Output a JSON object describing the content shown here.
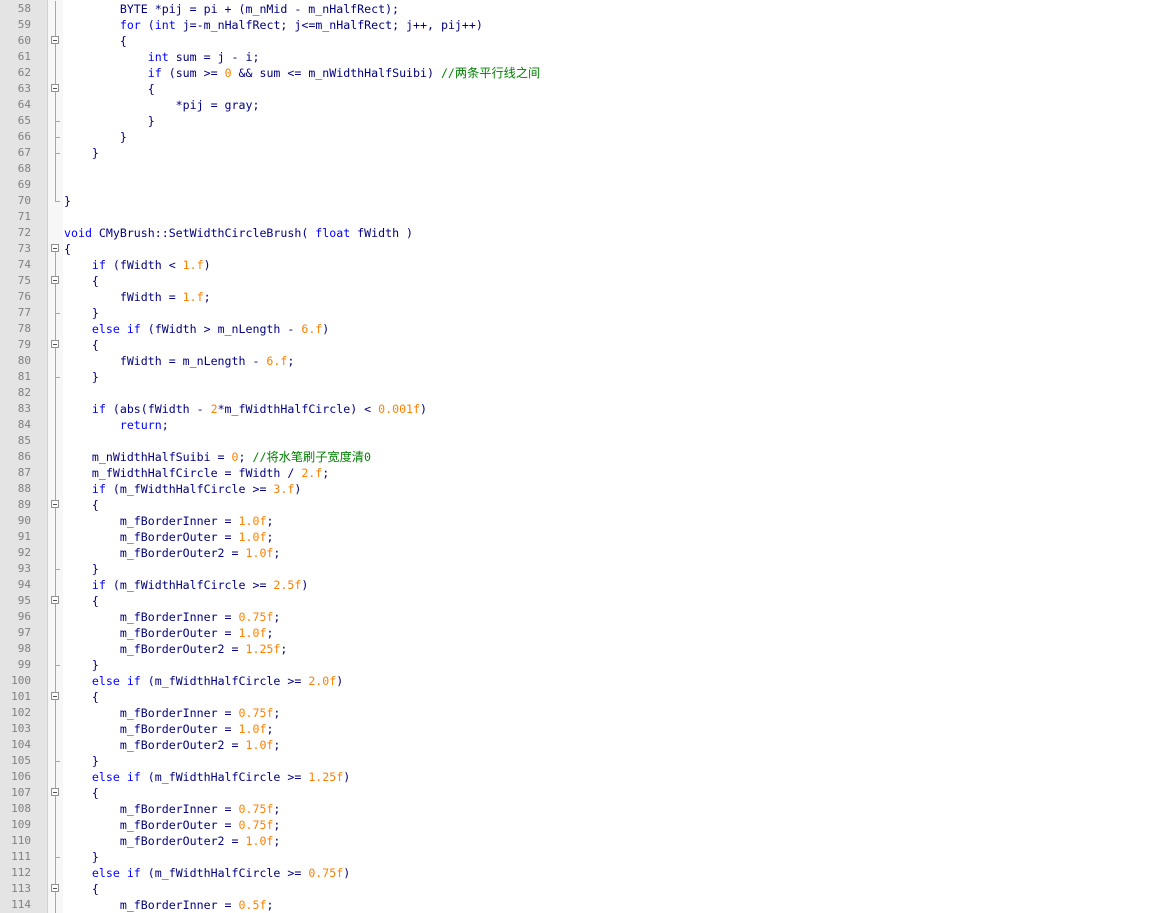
{
  "editor": {
    "colors": {
      "background": "#ffffff",
      "gutter": "#e4e4e4",
      "line_number": "#808080",
      "keyword": "#0000ff",
      "identifier": "#000080",
      "number": "#ff8000",
      "comment": "#008000"
    },
    "lines": [
      {
        "n": "58",
        "fold": "line",
        "tokens": [
          {
            "t": "        BYTE *pij = pi + (m_nMid - m_nHalfRect);",
            "c": ""
          }
        ]
      },
      {
        "n": "59",
        "fold": "line",
        "tokens": [
          {
            "t": "        ",
            "c": ""
          },
          {
            "t": "for",
            "c": "k"
          },
          {
            "t": " (",
            "c": ""
          },
          {
            "t": "int",
            "c": "k"
          },
          {
            "t": " j=-m_nHalfRect; j<=m_nHalfRect; j++, pij++)",
            "c": ""
          }
        ]
      },
      {
        "n": "60",
        "fold": "box",
        "tokens": [
          {
            "t": "        {",
            "c": ""
          }
        ]
      },
      {
        "n": "61",
        "fold": "line",
        "tokens": [
          {
            "t": "            ",
            "c": ""
          },
          {
            "t": "int",
            "c": "k"
          },
          {
            "t": " sum = j - i;",
            "c": ""
          }
        ]
      },
      {
        "n": "62",
        "fold": "line",
        "tokens": [
          {
            "t": "            ",
            "c": ""
          },
          {
            "t": "if",
            "c": "k"
          },
          {
            "t": " (sum >= ",
            "c": ""
          },
          {
            "t": "0",
            "c": "n"
          },
          {
            "t": " && sum <= m_nWidthHalfSuibi) ",
            "c": ""
          },
          {
            "t": "//",
            "c": "c"
          },
          {
            "t": "两条平行线之间",
            "c": "cc"
          }
        ]
      },
      {
        "n": "63",
        "fold": "box",
        "tokens": [
          {
            "t": "            {",
            "c": ""
          }
        ]
      },
      {
        "n": "64",
        "fold": "line",
        "tokens": [
          {
            "t": "                *pij = gray;",
            "c": ""
          }
        ]
      },
      {
        "n": "65",
        "fold": "end",
        "tokens": [
          {
            "t": "            }",
            "c": ""
          }
        ]
      },
      {
        "n": "66",
        "fold": "end",
        "tokens": [
          {
            "t": "        }",
            "c": ""
          }
        ]
      },
      {
        "n": "67",
        "fold": "end",
        "tokens": [
          {
            "t": "    }",
            "c": ""
          }
        ]
      },
      {
        "n": "68",
        "fold": "line",
        "tokens": []
      },
      {
        "n": "69",
        "fold": "line",
        "tokens": []
      },
      {
        "n": "70",
        "fold": "last",
        "tokens": [
          {
            "t": "}",
            "c": ""
          }
        ]
      },
      {
        "n": "71",
        "fold": "none",
        "tokens": []
      },
      {
        "n": "72",
        "fold": "none",
        "tokens": [
          {
            "t": "void",
            "c": "k"
          },
          {
            "t": " CMyBrush::SetWidthCircleBrush( ",
            "c": ""
          },
          {
            "t": "float",
            "c": "k"
          },
          {
            "t": " fWidth )",
            "c": ""
          }
        ]
      },
      {
        "n": "73",
        "fold": "top",
        "tokens": [
          {
            "t": "{",
            "c": ""
          }
        ]
      },
      {
        "n": "74",
        "fold": "line",
        "tokens": [
          {
            "t": "    ",
            "c": ""
          },
          {
            "t": "if",
            "c": "k"
          },
          {
            "t": " (fWidth < ",
            "c": ""
          },
          {
            "t": "1.f",
            "c": "n"
          },
          {
            "t": ")",
            "c": ""
          }
        ]
      },
      {
        "n": "75",
        "fold": "box",
        "tokens": [
          {
            "t": "    {",
            "c": ""
          }
        ]
      },
      {
        "n": "76",
        "fold": "line",
        "tokens": [
          {
            "t": "        fWidth = ",
            "c": ""
          },
          {
            "t": "1.f",
            "c": "n"
          },
          {
            "t": ";",
            "c": ""
          }
        ]
      },
      {
        "n": "77",
        "fold": "end",
        "tokens": [
          {
            "t": "    }",
            "c": ""
          }
        ]
      },
      {
        "n": "78",
        "fold": "line",
        "tokens": [
          {
            "t": "    ",
            "c": ""
          },
          {
            "t": "else if",
            "c": "k"
          },
          {
            "t": " (fWidth > m_nLength - ",
            "c": ""
          },
          {
            "t": "6.f",
            "c": "n"
          },
          {
            "t": ")",
            "c": ""
          }
        ]
      },
      {
        "n": "79",
        "fold": "box",
        "tokens": [
          {
            "t": "    {",
            "c": ""
          }
        ]
      },
      {
        "n": "80",
        "fold": "line",
        "tokens": [
          {
            "t": "        fWidth = m_nLength - ",
            "c": ""
          },
          {
            "t": "6.f",
            "c": "n"
          },
          {
            "t": ";",
            "c": ""
          }
        ]
      },
      {
        "n": "81",
        "fold": "end",
        "tokens": [
          {
            "t": "    }",
            "c": ""
          }
        ]
      },
      {
        "n": "82",
        "fold": "line",
        "tokens": []
      },
      {
        "n": "83",
        "fold": "line",
        "tokens": [
          {
            "t": "    ",
            "c": ""
          },
          {
            "t": "if",
            "c": "k"
          },
          {
            "t": " (abs(fWidth - ",
            "c": ""
          },
          {
            "t": "2",
            "c": "n"
          },
          {
            "t": "*m_fWidthHalfCircle) < ",
            "c": ""
          },
          {
            "t": "0.001f",
            "c": "n"
          },
          {
            "t": ")",
            "c": ""
          }
        ]
      },
      {
        "n": "84",
        "fold": "line",
        "tokens": [
          {
            "t": "        ",
            "c": ""
          },
          {
            "t": "return",
            "c": "k"
          },
          {
            "t": ";",
            "c": ""
          }
        ]
      },
      {
        "n": "85",
        "fold": "line",
        "tokens": []
      },
      {
        "n": "86",
        "fold": "line",
        "tokens": [
          {
            "t": "    m_nWidthHalfSuibi = ",
            "c": ""
          },
          {
            "t": "0",
            "c": "n"
          },
          {
            "t": "; ",
            "c": ""
          },
          {
            "t": "//",
            "c": "c"
          },
          {
            "t": "将水笔刷子宽度清",
            "c": "cc"
          },
          {
            "t": "0",
            "c": "c"
          }
        ]
      },
      {
        "n": "87",
        "fold": "line",
        "tokens": [
          {
            "t": "    m_fWidthHalfCircle = fWidth / ",
            "c": ""
          },
          {
            "t": "2.f",
            "c": "n"
          },
          {
            "t": ";",
            "c": ""
          }
        ]
      },
      {
        "n": "88",
        "fold": "line",
        "tokens": [
          {
            "t": "    ",
            "c": ""
          },
          {
            "t": "if",
            "c": "k"
          },
          {
            "t": " (m_fWidthHalfCircle >= ",
            "c": ""
          },
          {
            "t": "3.f",
            "c": "n"
          },
          {
            "t": ")",
            "c": ""
          }
        ]
      },
      {
        "n": "89",
        "fold": "box",
        "tokens": [
          {
            "t": "    {",
            "c": ""
          }
        ]
      },
      {
        "n": "90",
        "fold": "line",
        "tokens": [
          {
            "t": "        m_fBorderInner = ",
            "c": ""
          },
          {
            "t": "1.0f",
            "c": "n"
          },
          {
            "t": ";",
            "c": ""
          }
        ]
      },
      {
        "n": "91",
        "fold": "line",
        "tokens": [
          {
            "t": "        m_fBorderOuter = ",
            "c": ""
          },
          {
            "t": "1.0f",
            "c": "n"
          },
          {
            "t": ";",
            "c": ""
          }
        ]
      },
      {
        "n": "92",
        "fold": "line",
        "tokens": [
          {
            "t": "        m_fBorderOuter2 = ",
            "c": ""
          },
          {
            "t": "1.0f",
            "c": "n"
          },
          {
            "t": ";",
            "c": ""
          }
        ]
      },
      {
        "n": "93",
        "fold": "end",
        "tokens": [
          {
            "t": "    }",
            "c": ""
          }
        ]
      },
      {
        "n": "94",
        "fold": "line",
        "tokens": [
          {
            "t": "    ",
            "c": ""
          },
          {
            "t": "if",
            "c": "k"
          },
          {
            "t": " (m_fWidthHalfCircle >= ",
            "c": ""
          },
          {
            "t": "2.5f",
            "c": "n"
          },
          {
            "t": ")",
            "c": ""
          }
        ]
      },
      {
        "n": "95",
        "fold": "box",
        "tokens": [
          {
            "t": "    {",
            "c": ""
          }
        ]
      },
      {
        "n": "96",
        "fold": "line",
        "tokens": [
          {
            "t": "        m_fBorderInner = ",
            "c": ""
          },
          {
            "t": "0.75f",
            "c": "n"
          },
          {
            "t": ";",
            "c": ""
          }
        ]
      },
      {
        "n": "97",
        "fold": "line",
        "tokens": [
          {
            "t": "        m_fBorderOuter = ",
            "c": ""
          },
          {
            "t": "1.0f",
            "c": "n"
          },
          {
            "t": ";",
            "c": ""
          }
        ]
      },
      {
        "n": "98",
        "fold": "line",
        "tokens": [
          {
            "t": "        m_fBorderOuter2 = ",
            "c": ""
          },
          {
            "t": "1.25f",
            "c": "n"
          },
          {
            "t": ";",
            "c": ""
          }
        ]
      },
      {
        "n": "99",
        "fold": "end",
        "tokens": [
          {
            "t": "    }",
            "c": ""
          }
        ]
      },
      {
        "n": "100",
        "fold": "line",
        "tokens": [
          {
            "t": "    ",
            "c": ""
          },
          {
            "t": "else if",
            "c": "k"
          },
          {
            "t": " (m_fWidthHalfCircle >= ",
            "c": ""
          },
          {
            "t": "2.0f",
            "c": "n"
          },
          {
            "t": ")",
            "c": ""
          }
        ]
      },
      {
        "n": "101",
        "fold": "box",
        "tokens": [
          {
            "t": "    {",
            "c": ""
          }
        ]
      },
      {
        "n": "102",
        "fold": "line",
        "tokens": [
          {
            "t": "        m_fBorderInner = ",
            "c": ""
          },
          {
            "t": "0.75f",
            "c": "n"
          },
          {
            "t": ";",
            "c": ""
          }
        ]
      },
      {
        "n": "103",
        "fold": "line",
        "tokens": [
          {
            "t": "        m_fBorderOuter = ",
            "c": ""
          },
          {
            "t": "1.0f",
            "c": "n"
          },
          {
            "t": ";",
            "c": ""
          }
        ]
      },
      {
        "n": "104",
        "fold": "line",
        "tokens": [
          {
            "t": "        m_fBorderOuter2 = ",
            "c": ""
          },
          {
            "t": "1.0f",
            "c": "n"
          },
          {
            "t": ";",
            "c": ""
          }
        ]
      },
      {
        "n": "105",
        "fold": "end",
        "tokens": [
          {
            "t": "    }",
            "c": ""
          }
        ]
      },
      {
        "n": "106",
        "fold": "line",
        "tokens": [
          {
            "t": "    ",
            "c": ""
          },
          {
            "t": "else if",
            "c": "k"
          },
          {
            "t": " (m_fWidthHalfCircle >= ",
            "c": ""
          },
          {
            "t": "1.25f",
            "c": "n"
          },
          {
            "t": ")",
            "c": ""
          }
        ]
      },
      {
        "n": "107",
        "fold": "box",
        "tokens": [
          {
            "t": "    {",
            "c": ""
          }
        ]
      },
      {
        "n": "108",
        "fold": "line",
        "tokens": [
          {
            "t": "        m_fBorderInner = ",
            "c": ""
          },
          {
            "t": "0.75f",
            "c": "n"
          },
          {
            "t": ";",
            "c": ""
          }
        ]
      },
      {
        "n": "109",
        "fold": "line",
        "tokens": [
          {
            "t": "        m_fBorderOuter = ",
            "c": ""
          },
          {
            "t": "0.75f",
            "c": "n"
          },
          {
            "t": ";",
            "c": ""
          }
        ]
      },
      {
        "n": "110",
        "fold": "line",
        "tokens": [
          {
            "t": "        m_fBorderOuter2 = ",
            "c": ""
          },
          {
            "t": "1.0f",
            "c": "n"
          },
          {
            "t": ";",
            "c": ""
          }
        ]
      },
      {
        "n": "111",
        "fold": "end",
        "tokens": [
          {
            "t": "    }",
            "c": ""
          }
        ]
      },
      {
        "n": "112",
        "fold": "line",
        "tokens": [
          {
            "t": "    ",
            "c": ""
          },
          {
            "t": "else if",
            "c": "k"
          },
          {
            "t": " (m_fWidthHalfCircle >= ",
            "c": ""
          },
          {
            "t": "0.75f",
            "c": "n"
          },
          {
            "t": ")",
            "c": ""
          }
        ]
      },
      {
        "n": "113",
        "fold": "box",
        "tokens": [
          {
            "t": "    {",
            "c": ""
          }
        ]
      },
      {
        "n": "114",
        "fold": "line",
        "tokens": [
          {
            "t": "        m_fBorderInner = ",
            "c": ""
          },
          {
            "t": "0.5f",
            "c": "n"
          },
          {
            "t": ";",
            "c": ""
          }
        ]
      }
    ]
  }
}
